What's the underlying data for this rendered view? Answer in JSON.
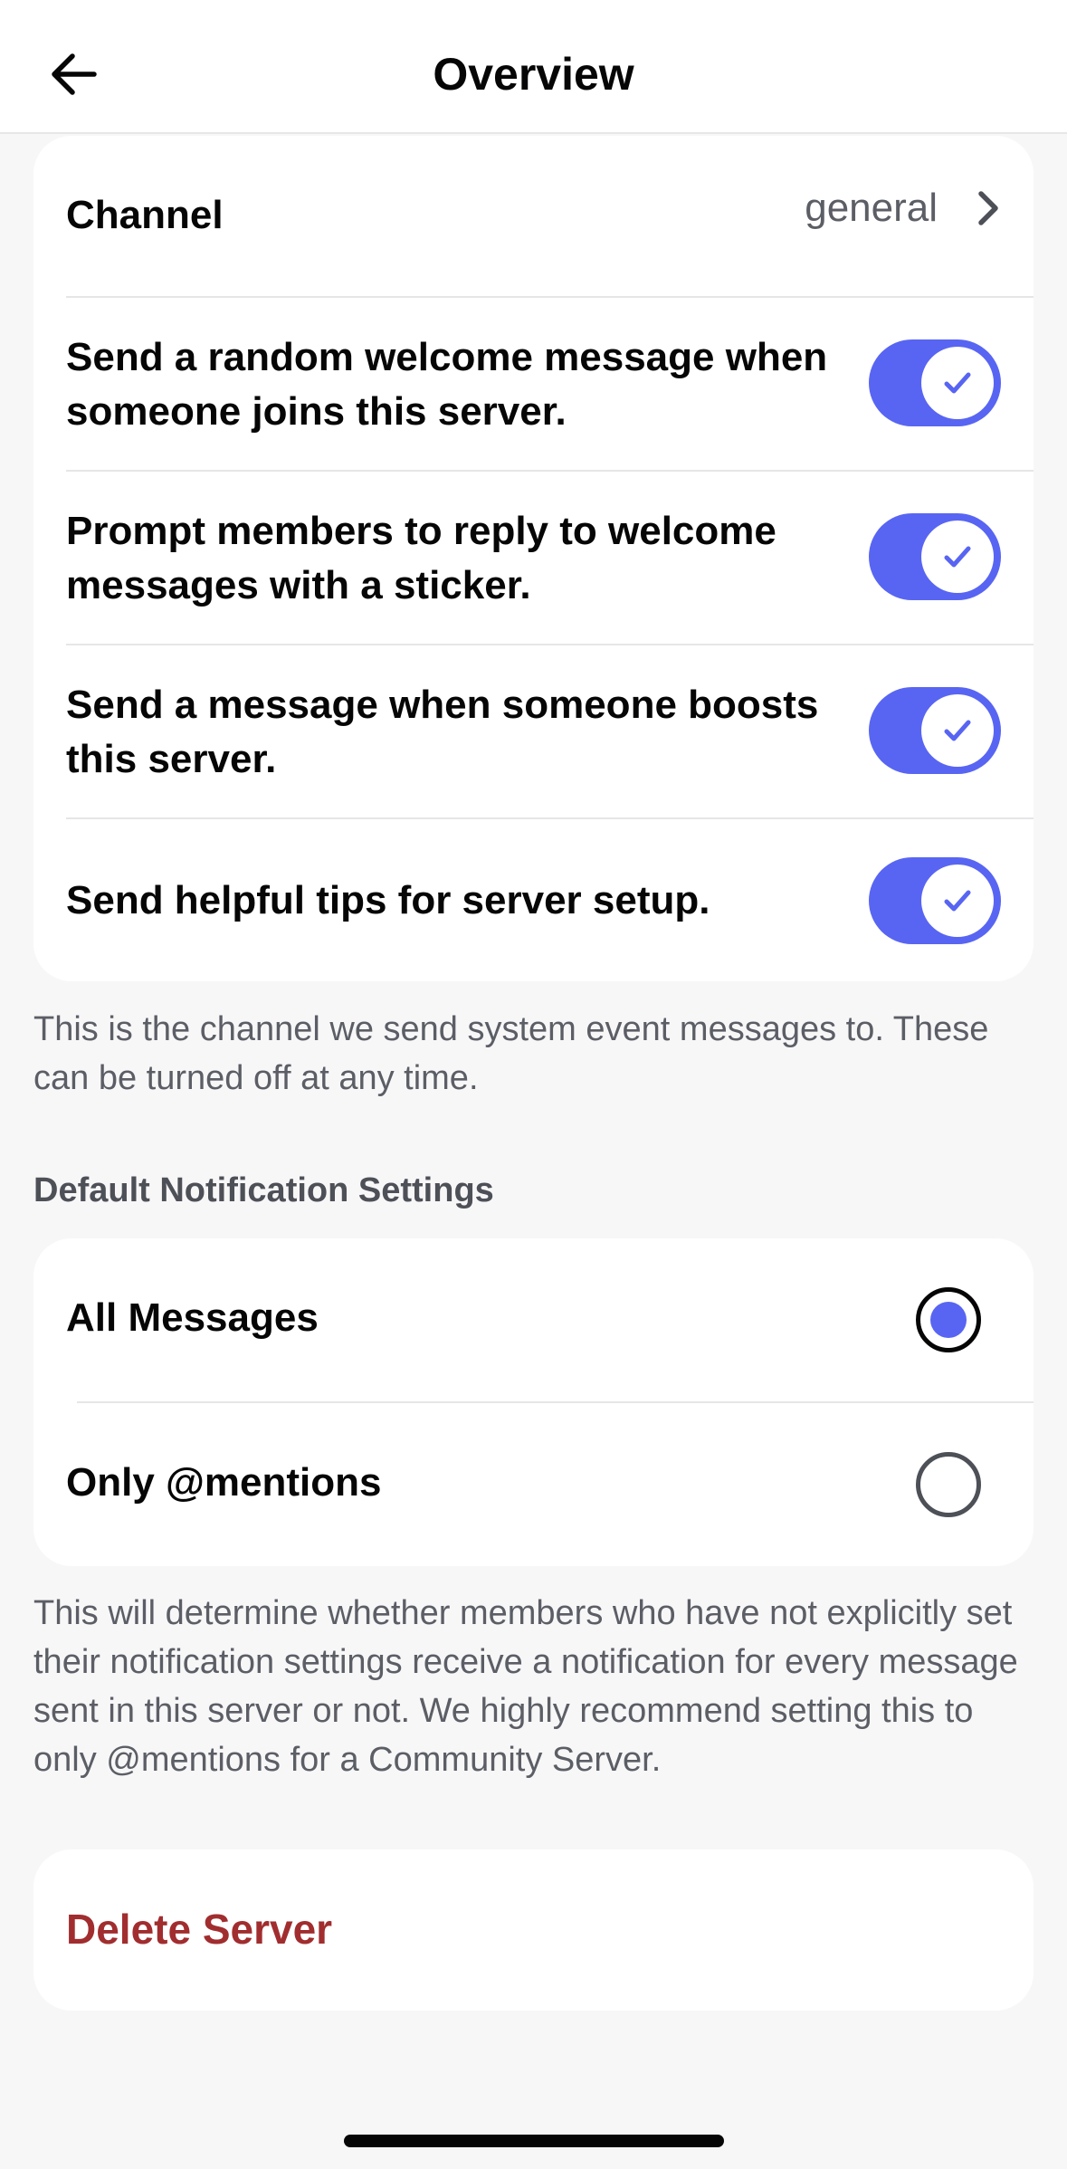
{
  "header": {
    "title": "Overview",
    "back_icon": "arrow-left-icon"
  },
  "system_messages": {
    "channel_label": "Channel",
    "channel_value": "general",
    "toggles": [
      {
        "label": "Send a random welcome message when someone joins this server.",
        "on": true
      },
      {
        "label": "Prompt members to reply to welcome messages with a sticker.",
        "on": true
      },
      {
        "label": "Send a message when someone boosts this server.",
        "on": true
      },
      {
        "label": "Send helpful tips for server setup.",
        "on": true
      }
    ],
    "helper_text": "This is the channel we send system event messages to. These can be turned off at any time."
  },
  "notifications": {
    "heading": "Default Notification Settings",
    "options": [
      {
        "label": "All Messages",
        "selected": true
      },
      {
        "label": "Only @mentions",
        "selected": false
      }
    ],
    "helper_text": "This will determine whether members who have not explicitly set their notification settings receive a notification for every message sent in this server or not. We highly recommend setting this to only @mentions for a Community Server."
  },
  "danger": {
    "delete_label": "Delete Server"
  },
  "colors": {
    "accent": "#5865f2",
    "danger": "#a12d2f",
    "background": "#f7f7f8",
    "card": "#ffffff"
  }
}
